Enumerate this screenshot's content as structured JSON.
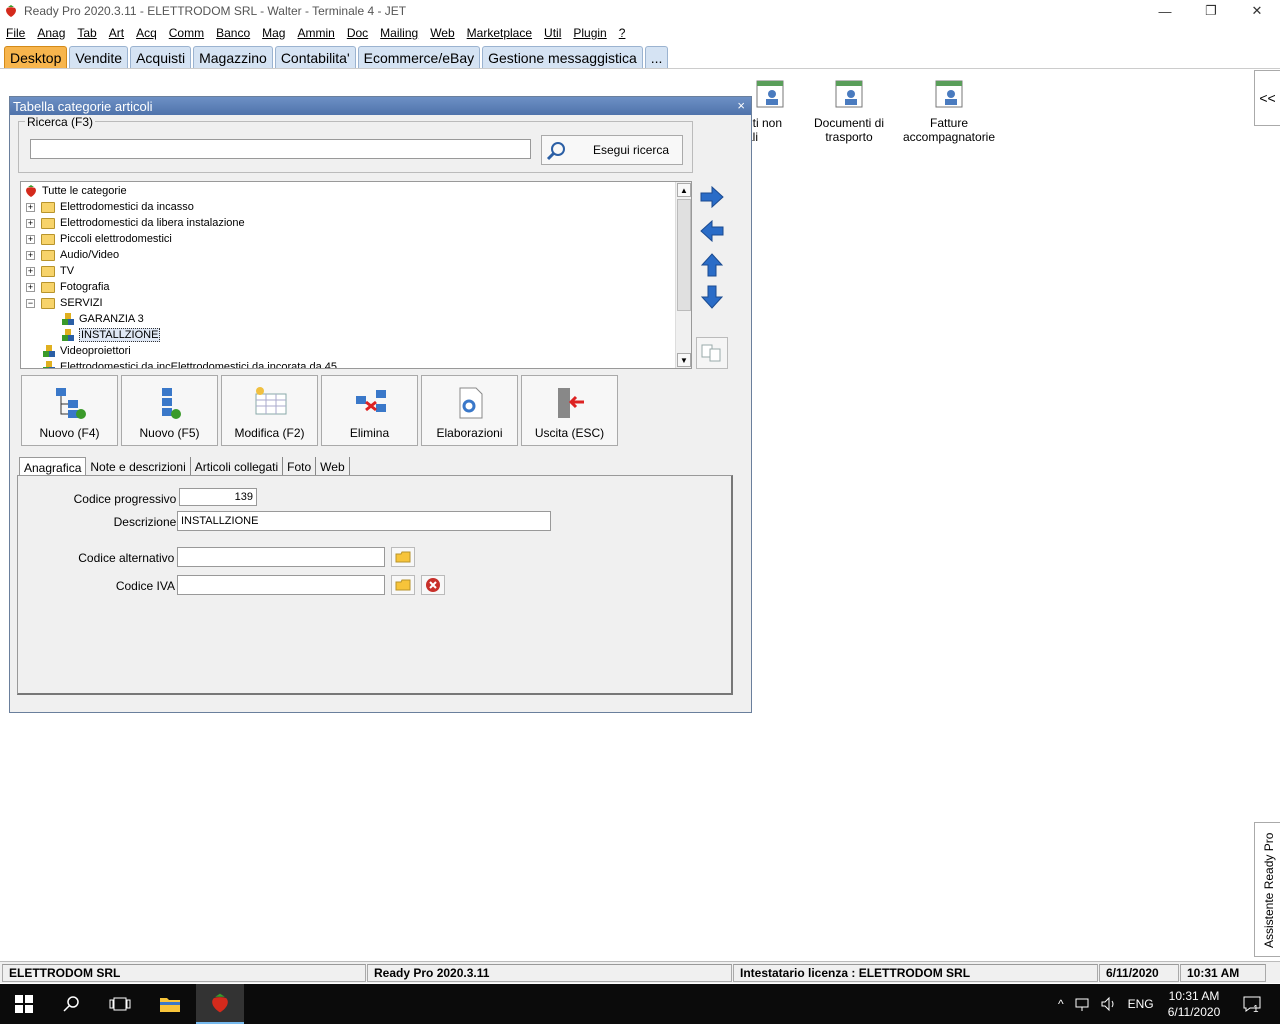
{
  "window": {
    "title": "Ready Pro 2020.3.11 - ELETTRODOM SRL - Walter - Terminale 4 - JET",
    "minimize": "—",
    "restore": "❐",
    "close": "✕"
  },
  "menu": [
    "File",
    "Anag",
    "Tab",
    "Art",
    "Acq",
    "Comm",
    "Banco",
    "Mag",
    "Ammin",
    "Doc",
    "Mailing",
    "Web",
    "Marketplace",
    "Util",
    "Plugin",
    "?"
  ],
  "main_tabs": [
    "Desktop",
    "Vendite",
    "Acquisti",
    "Magazzino",
    "Contabilita'",
    "Ecommerce/eBay",
    "Gestione messaggistica",
    "..."
  ],
  "desktop": {
    "icons": [
      {
        "label": "nti non\nali",
        "icon": "document-person-icon"
      },
      {
        "label": "Documenti di trasporto",
        "icon": "document-person-icon"
      },
      {
        "label": "Fatture accompagnatorie",
        "icon": "document-person-icon"
      }
    ],
    "sidebar_toggle": "<<",
    "assistente": "Assistente Ready Pro"
  },
  "dialog": {
    "title": "Tabella categorie articoli",
    "close": "×",
    "search_group_label": "Ricerca (F3)",
    "search_value": "",
    "search_button": "Esegui ricerca",
    "tree": [
      {
        "label": "Tutte le categorie",
        "level": 0,
        "type": "root"
      },
      {
        "label": "Elettrodomestici da incasso",
        "level": 1,
        "type": "folder",
        "expander": "+"
      },
      {
        "label": "Elettrodomestici da libera instalazione",
        "level": 1,
        "type": "folder",
        "expander": "+"
      },
      {
        "label": "Piccoli elettrodomestici",
        "level": 1,
        "type": "folder",
        "expander": "+"
      },
      {
        "label": "Audio/Video",
        "level": 1,
        "type": "folder",
        "expander": "+"
      },
      {
        "label": "TV",
        "level": 1,
        "type": "folder",
        "expander": "+"
      },
      {
        "label": "Fotografia",
        "level": 1,
        "type": "folder",
        "expander": "+"
      },
      {
        "label": "SERVIZI",
        "level": 1,
        "type": "folder",
        "expander": "−"
      },
      {
        "label": "GARANZIA 3",
        "level": 2,
        "type": "node"
      },
      {
        "label": "INSTALLZIONE",
        "level": 2,
        "type": "node",
        "selected": true
      },
      {
        "label": "Videoproiettori",
        "level": 1,
        "type": "node"
      },
      {
        "label": "Elettrodomestici da incElettrodomestici da incorata da 45",
        "level": 1,
        "type": "node"
      }
    ],
    "toolbar": [
      "Nuovo (F4)",
      "Nuovo (F5)",
      "Modifica (F2)",
      "Elimina",
      "Elaborazioni",
      "Uscita (ESC)"
    ],
    "subtabs": [
      "Anagrafica",
      "Note e descrizioni",
      "Articoli collegati",
      "Foto",
      "Web"
    ],
    "form": {
      "codice_progressivo_label": "Codice progressivo :",
      "codice_progressivo": "139",
      "descrizione_label": "Descrizione :",
      "descrizione": "INSTALLZIONE",
      "codice_alternativo_label": "Codice alternativo :",
      "codice_alternativo": "",
      "codice_iva_label": "Codice IVA :",
      "codice_iva": ""
    }
  },
  "statusbar": {
    "company": "ELETTRODOM SRL",
    "version": "Ready Pro 2020.3.11",
    "license": "Intestatario licenza : ELETTRODOM SRL",
    "date": "6/11/2020",
    "time": "10:31 AM"
  },
  "taskbar": {
    "language": "ENG",
    "clock_time": "10:31 AM",
    "clock_date": "6/11/2020",
    "notification_count": "1"
  },
  "colors": {
    "active_tab": "#f7b54d",
    "tab": "#d5e3f3",
    "dialog_title": "#5b7fb8",
    "arrow_blue": "#2a6cc7"
  }
}
